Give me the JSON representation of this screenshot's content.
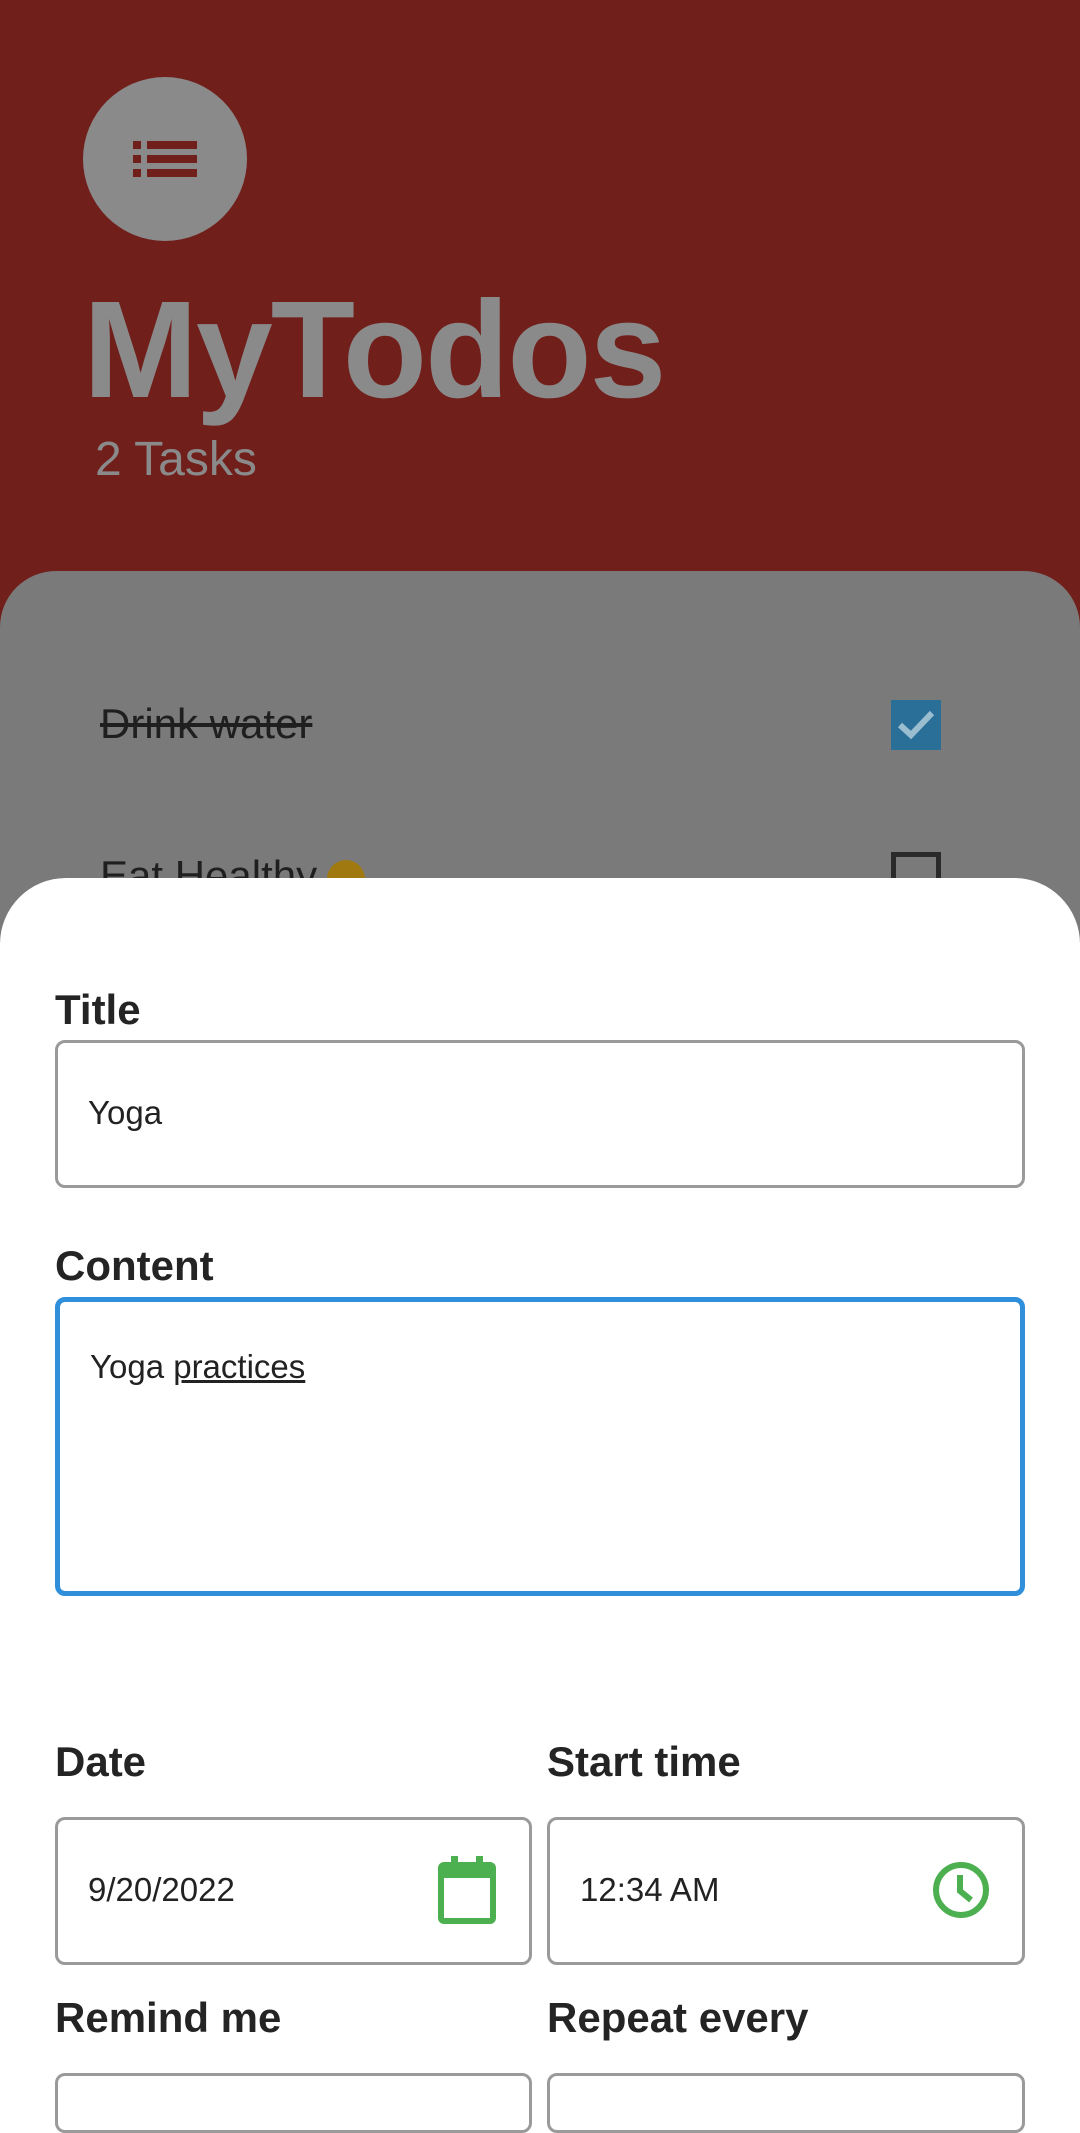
{
  "app": {
    "title": "MyTodos",
    "task_count": "2 Tasks",
    "todos": [
      {
        "text": "Drink water",
        "done": true
      },
      {
        "text": "Eat Healthy",
        "done": false
      }
    ]
  },
  "form": {
    "title_label": "Title",
    "title_value": "Yoga",
    "content_label": "Content",
    "content_value_plain": "Yoga ",
    "content_value_underlined": "practices",
    "date_label": "Date",
    "date_value": "9/20/2022",
    "start_time_label": "Start time",
    "start_time_value": "12:34 AM",
    "remind_label": "Remind me",
    "repeat_label": "Repeat every"
  },
  "icons": {
    "menu": "list-icon",
    "date": "calendar-icon",
    "time": "clock-icon",
    "checkbox": "check-icon"
  },
  "colors": {
    "header_bg": "#711f1b",
    "focus_border": "#2f8fdb",
    "icon_green": "#4caf50",
    "checkbox_blue": "#2a6f97"
  }
}
